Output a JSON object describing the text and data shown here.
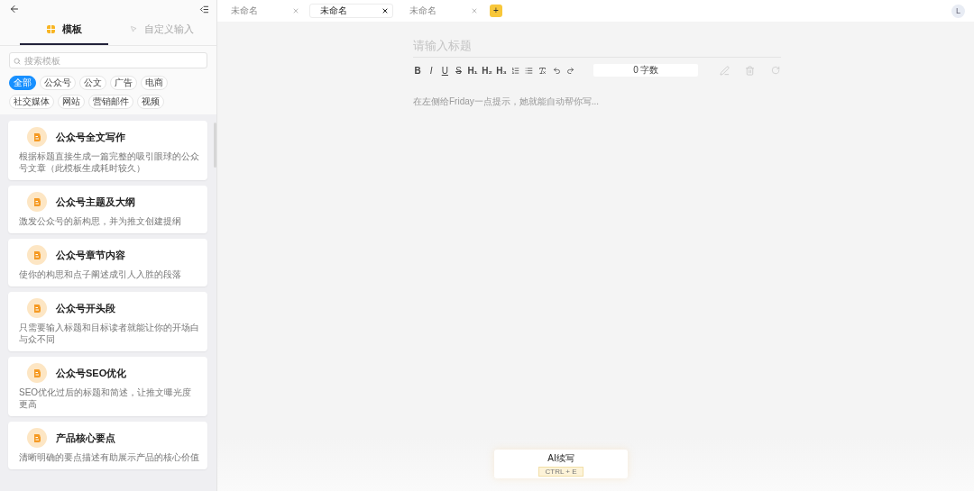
{
  "sidebar": {
    "tabs": [
      {
        "label": "模板",
        "selected": true
      },
      {
        "label": "自定义输入",
        "selected": false
      }
    ],
    "search": {
      "placeholder": "搜索模板"
    },
    "filters": [
      {
        "label": "全部",
        "selected": true
      },
      {
        "label": "公众号",
        "selected": false
      },
      {
        "label": "公文",
        "selected": false
      },
      {
        "label": "广告",
        "selected": false
      },
      {
        "label": "电商",
        "selected": false
      },
      {
        "label": "社交媒体",
        "selected": false
      },
      {
        "label": "网站",
        "selected": false
      },
      {
        "label": "营销邮件",
        "selected": false
      },
      {
        "label": "视频",
        "selected": false
      }
    ],
    "templates": [
      {
        "title": "公众号全文写作",
        "description": "根据标题直接生成一篇完整的吸引眼球的公众号文章（此模板生成耗时较久）"
      },
      {
        "title": "公众号主题及大纲",
        "description": "激发公众号的新构思，并为推文创建提纲"
      },
      {
        "title": "公众号章节内容",
        "description": "使你的构思和点子阐述成引人入胜的段落"
      },
      {
        "title": "公众号开头段",
        "description": "只需要输入标题和目标读者就能让你的开场白与众不同"
      },
      {
        "title": "公众号SEO优化",
        "description": "SEO优化过后的标题和简述，让推文曝光度更高"
      },
      {
        "title": "产品核心要点",
        "description": "清晰明确的要点描述有助展示产品的核心价值"
      }
    ]
  },
  "doc_tabs": [
    {
      "label": "未命名",
      "selected": false
    },
    {
      "label": "未命名",
      "selected": true
    },
    {
      "label": "未命名",
      "selected": false
    }
  ],
  "new_tab": {
    "label": "+"
  },
  "avatar": {
    "label": "L"
  },
  "editor": {
    "title_placeholder": "请输入标题",
    "toolbar": [
      {
        "kind": "bold",
        "label": "B"
      },
      {
        "kind": "italic",
        "label": "I"
      },
      {
        "kind": "underline",
        "label": "U"
      },
      {
        "kind": "strike",
        "label": "S"
      },
      {
        "kind": "heading",
        "label": "H₁"
      },
      {
        "kind": "heading",
        "label": "H₂"
      },
      {
        "kind": "heading",
        "label": "H₃"
      },
      {
        "kind": "ordered-list"
      },
      {
        "kind": "bullet-list"
      },
      {
        "kind": "clear-format"
      },
      {
        "kind": "undo"
      },
      {
        "kind": "redo"
      }
    ],
    "word_count": "0 字数",
    "body_placeholder": "在左侧给Friday一点提示，她就能自动帮你写..."
  },
  "ai_button": {
    "label": "AI续写",
    "shortcut": "CTRL + E"
  }
}
